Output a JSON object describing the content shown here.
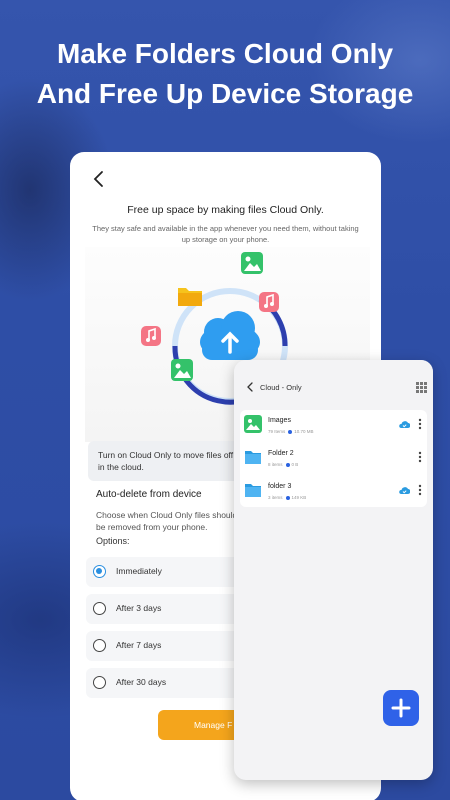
{
  "headline": {
    "line1": "Make Folders Cloud Only",
    "line2": "And Free Up Device Storage"
  },
  "main_screen": {
    "title": "Free up space by making files Cloud Only.",
    "subtitle": "They stay safe and available in the app whenever you need them, without taking up storage on your phone.",
    "info_text": "Turn on Cloud Only to move files off your device and keep them safe in the cloud.",
    "auto_delete_title": "Auto-delete from device",
    "auto_delete_desc": "Choose when Cloud Only files should be removed from your phone.",
    "options_label": "Options:",
    "options": [
      {
        "label": "Immediately",
        "selected": true
      },
      {
        "label": "After 3 days",
        "selected": false
      },
      {
        "label": "After 7 days",
        "selected": false
      },
      {
        "label": "After 30 days",
        "selected": false
      }
    ],
    "manage_button": "Manage F",
    "accent_color": "#f4a51c",
    "radio_color": "#2a8fe0"
  },
  "cloud_only_screen": {
    "title": "Cloud - Only",
    "files": [
      {
        "name": "Images",
        "count": "79 Items",
        "size": "10.70 MB",
        "icon": "image-file-icon",
        "cloud_synced": true
      },
      {
        "name": "Folder 2",
        "count": "8 items",
        "size": "0 B",
        "icon": "folder-icon",
        "cloud_synced": false
      },
      {
        "name": "folder 3",
        "count": "3 items",
        "size": "149 KB",
        "icon": "folder-icon",
        "cloud_synced": true
      }
    ],
    "fab_color": "#2f62e8"
  }
}
